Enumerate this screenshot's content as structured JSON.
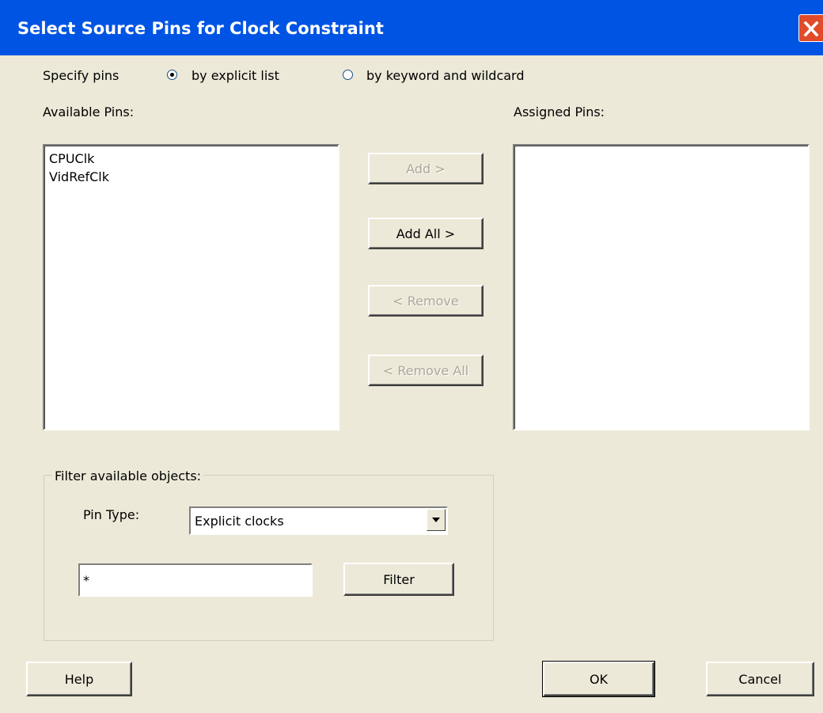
{
  "window": {
    "title": "Select Source Pins for Clock Constraint"
  },
  "specify": {
    "label": "Specify pins",
    "options": [
      "by explicit list",
      "by keyword and wildcard"
    ],
    "selected": "by explicit list"
  },
  "available": {
    "label": "Available Pins:",
    "items": [
      "CPUClk",
      "VidRefClk"
    ]
  },
  "assigned": {
    "label": "Assigned Pins:",
    "items": []
  },
  "buttons": {
    "add": "Add >",
    "add_all": "Add All >",
    "remove": "< Remove",
    "remove_all": "< Remove All",
    "filter": "Filter",
    "help": "Help",
    "ok": "OK",
    "cancel": "Cancel"
  },
  "filter_group": {
    "label": "Filter available objects:",
    "pin_type_label": "Pin Type:",
    "pin_type_value": "Explicit clocks",
    "pattern_value": "*"
  },
  "icons": {
    "close": "close-icon",
    "dropdown": "chevron-down-icon"
  },
  "colors": {
    "titlebar": "#0054e3",
    "face": "#ece9d8",
    "close": "#e14b2a"
  }
}
